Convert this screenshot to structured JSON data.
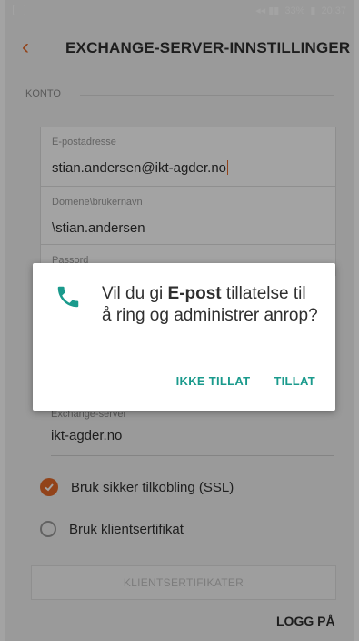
{
  "status_bar": {
    "battery": "33%",
    "time": "20:37"
  },
  "app_bar": {
    "title": "EXCHANGE-SERVER-INNSTILLINGER"
  },
  "account": {
    "section_label": "KONTO",
    "email_label": "E-postadresse",
    "email_value": "stian.andersen@ikt-agder.no",
    "domain_label": "Domene\\brukernavn",
    "domain_value": "\\stian.andersen",
    "password_label": "Passord"
  },
  "server": {
    "exchange_label": "Exchange-server",
    "exchange_value": "ikt-agder.no"
  },
  "options": [
    {
      "label": "Bruk sikker tilkobling (SSL)",
      "checked": true
    },
    {
      "label": "Bruk klientsertifikat",
      "checked": false
    }
  ],
  "buttons": {
    "client_certs": "KLIENTSERTIFIKATER",
    "login": "LOGG PÅ"
  },
  "dialog": {
    "text_before": "Vil du gi ",
    "app_name": "E-post",
    "text_after": " tillatelse til å ring og administrer anrop?",
    "deny": "IKKE TILLAT",
    "allow": "TILLAT"
  },
  "colors": {
    "accent": "#e46a2a",
    "dialog_button": "#1a9a8c",
    "phone_icon": "#1a9a8c"
  }
}
